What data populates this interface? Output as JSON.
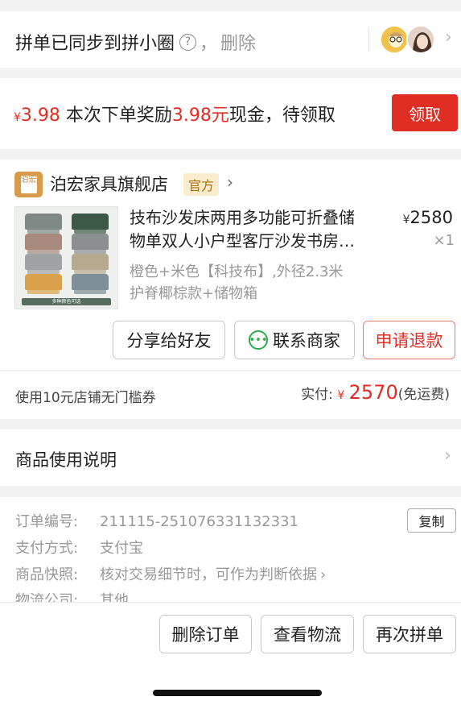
{
  "sync": {
    "title": "拼单已同步到拼小圈",
    "help_glyph": "?",
    "separator": "，",
    "delete_label": "删除"
  },
  "reward": {
    "currency": "¥",
    "amount": "3.98",
    "text_before": "本次下单奖励",
    "highlight": "3.98元",
    "text_after": "现金，待领取",
    "claim_label": "领取"
  },
  "order": {
    "shop_logo_text": "泊宏",
    "shop_name": "泊宏家具旗舰店",
    "official_badge": "官方",
    "product": {
      "title_line1": "技布沙发床两用多功能可折叠储",
      "title_line2": "物单双人小户型客厅沙发书房…",
      "currency": "¥",
      "price": "2580",
      "quantity": "×1",
      "spec_line1": "橙色+米色【科技布】,外径2.3米",
      "spec_line2": "护脊椰棕款+储物箱",
      "thumb_caption": "多种颜色可选"
    },
    "actions": {
      "share": "分享给好友",
      "contact": "联系商家",
      "refund": "申请退款"
    },
    "coupon_text": "使用10元店铺无门槛券",
    "paid_label": "实付: ",
    "paid_currency": "¥",
    "paid_amount": "2570",
    "shipping_note": "(免运费)"
  },
  "instructions": {
    "label": "商品使用说明"
  },
  "info": {
    "order_no_label": "订单编号:",
    "order_no": "211115-251076331132331",
    "copy_label": "复制",
    "payment_label": "支付方式:",
    "payment": "支付宝",
    "snapshot_label": "商品快照:",
    "snapshot": "核对交易细节时，可作为判断依据",
    "logistics_label": "物流公司:",
    "logistics": "其他"
  },
  "bottom": {
    "delete_order": "删除订单",
    "view_logistics": "查看物流",
    "rebuy": "再次拼单"
  },
  "colors": {
    "accent_red": "#e02e24",
    "badge_bg": "#fbeccd",
    "badge_text": "#a57010",
    "chat_green": "#2daa48"
  }
}
